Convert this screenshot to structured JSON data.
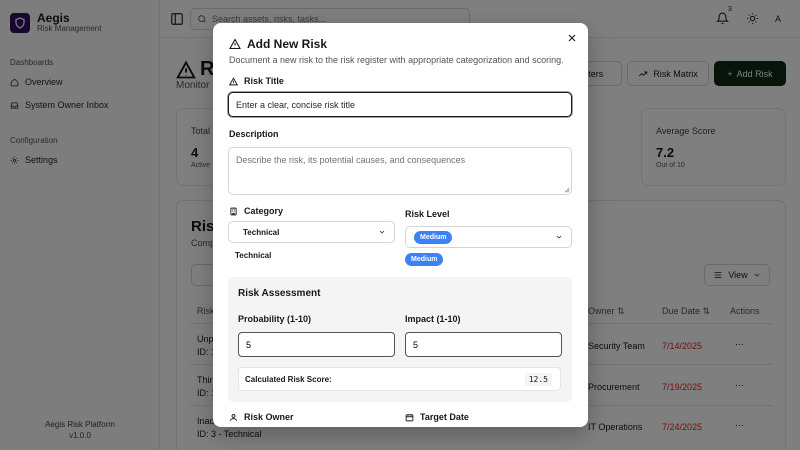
{
  "app": {
    "name": "Aegis",
    "tagline": "Risk Management",
    "footer_line1": "Aegis Risk Platform",
    "footer_line2": "v1.0.0"
  },
  "sidebar": {
    "sections": [
      {
        "title": "Dashboards",
        "items": [
          {
            "label": "Overview",
            "icon": "home-icon"
          },
          {
            "label": "System Owner Inbox",
            "icon": "inbox-icon"
          }
        ]
      },
      {
        "title": "Configuration",
        "items": [
          {
            "label": "Settings",
            "icon": "gear-icon"
          }
        ]
      }
    ]
  },
  "topbar": {
    "search_placeholder": "Search assets, risks, tasks...",
    "notification_count": "3",
    "avatar_initial": "A"
  },
  "page": {
    "title": "Ri",
    "subtitle": "Monitor",
    "filters_label": "Filters",
    "matrix_label": "Risk Matrix",
    "add_label": "Add Risk"
  },
  "stats": [
    {
      "label": "Total",
      "value": "4",
      "sub": "Active"
    },
    {
      "label": "Average Score",
      "value": "7.2",
      "sub": "Out of 10"
    }
  ],
  "table": {
    "title": "Risk",
    "subtitle": "Comp",
    "view_label": "View",
    "columns": [
      "Risk",
      "Owner",
      "Due Date",
      "Actions"
    ],
    "rows": [
      {
        "name": "Unp",
        "id": "ID: 1",
        "owner": "Security Team",
        "due": "7/14/2025"
      },
      {
        "name": "Thir",
        "id": "ID: 1",
        "owner": "Procurement",
        "due": "7/19/2025"
      },
      {
        "name": "Inac",
        "id": "ID: 3 - Technical",
        "owner": "IT Operations",
        "due": "7/24/2025"
      }
    ]
  },
  "modal": {
    "title": "Add New Risk",
    "description": "Document a new risk to the risk register with appropriate categorization and scoring.",
    "risk_title_label": "Risk Title",
    "risk_title_placeholder": "Enter a clear, concise risk title",
    "description_label": "Description",
    "description_placeholder": "Describe the risk, its potential causes, and consequences",
    "category_label": "Category",
    "category_value": "Technical",
    "category_display": "Technical",
    "risk_level_label": "Risk Level",
    "risk_level_value": "Medium",
    "risk_level_display": "Medium",
    "assessment_title": "Risk Assessment",
    "probability_label": "Probability (1-10)",
    "probability_value": "5",
    "impact_label": "Impact (1-10)",
    "impact_value": "5",
    "score_label": "Calculated Risk Score:",
    "score_value": "12.5",
    "owner_label": "Risk Owner",
    "target_date_label": "Target Date"
  },
  "colors": {
    "accent": "#3b82f6",
    "overdue": "#dc2626",
    "primary_button": "#0a2a14"
  }
}
